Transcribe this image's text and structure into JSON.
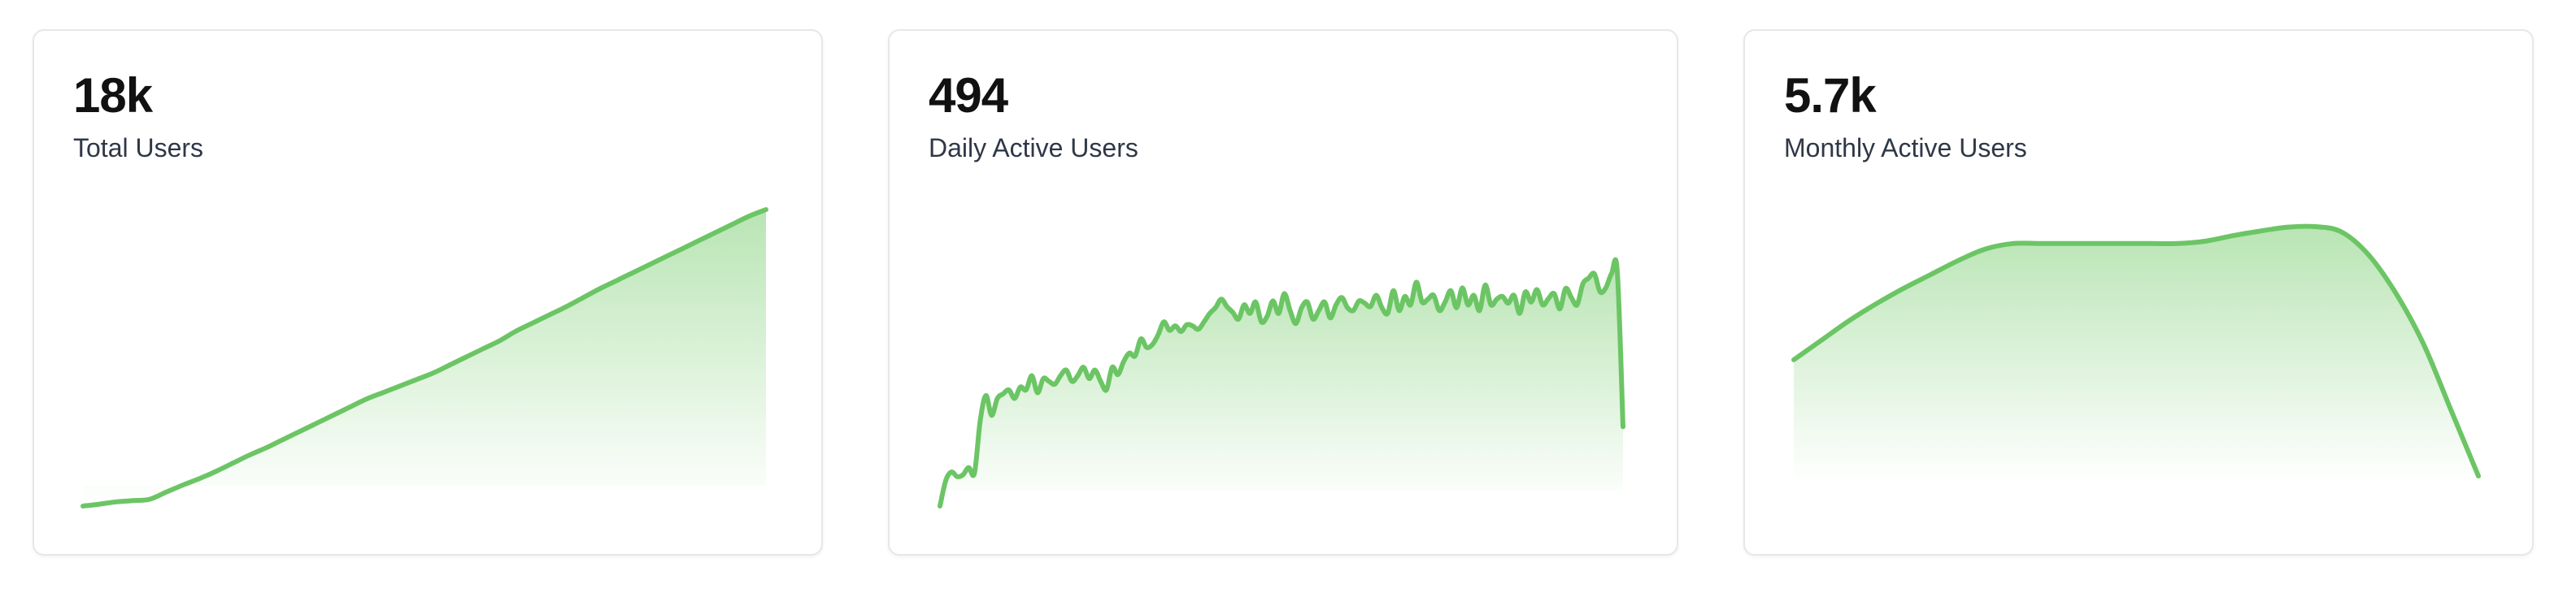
{
  "colors": {
    "line": "#6cc565",
    "fill_top": "#7fcf76"
  },
  "cards": [
    {
      "value": "18k",
      "label": "Total Users",
      "chart_data": {
        "type": "area",
        "y": [
          0,
          120,
          260,
          340,
          420,
          860,
          1300,
          1700,
          2150,
          2650,
          3150,
          3600,
          4100,
          4600,
          5100,
          5600,
          6100,
          6600,
          7000,
          7400,
          7800,
          8200,
          8700,
          9200,
          9700,
          10200,
          10800,
          11300,
          11800,
          12300,
          12850,
          13400,
          13900,
          14400,
          14900,
          15400,
          15900,
          16400,
          16900,
          17400,
          17900,
          18300
        ],
        "ylim": [
          0,
          18300
        ]
      }
    },
    {
      "value": "494",
      "label": "Daily Active Users",
      "chart_data": {
        "type": "area",
        "y": [
          0,
          45,
          60,
          52,
          55,
          68,
          58,
          150,
          195,
          160,
          190,
          198,
          205,
          190,
          210,
          205,
          230,
          200,
          225,
          220,
          215,
          230,
          240,
          220,
          230,
          245,
          225,
          240,
          220,
          205,
          245,
          232,
          255,
          270,
          265,
          295,
          280,
          285,
          302,
          325,
          310,
          318,
          308,
          320,
          318,
          312,
          325,
          340,
          350,
          365,
          352,
          342,
          330,
          355,
          340,
          360,
          325,
          335,
          362,
          340,
          375,
          345,
          322,
          350,
          360,
          330,
          345,
          360,
          332,
          355,
          368,
          350,
          345,
          362,
          358,
          352,
          372,
          350,
          340,
          380,
          345,
          370,
          355,
          395,
          360,
          365,
          372,
          345,
          360,
          380,
          350,
          385,
          355,
          372,
          345,
          390,
          355,
          365,
          370,
          358,
          372,
          340,
          378,
          360,
          382,
          355,
          366,
          375,
          348,
          384,
          368,
          355,
          392,
          402,
          410,
          378,
          385,
          410,
          415,
          140
        ],
        "ylim": [
          0,
          430
        ]
      }
    },
    {
      "value": "5.7k",
      "label": "Monthly Active Users",
      "chart_data": {
        "type": "area",
        "y": [
          3800,
          4050,
          4300,
          4520,
          4720,
          4900,
          5080,
          5230,
          5300,
          5300,
          5300,
          5300,
          5300,
          5300,
          5300,
          5330,
          5400,
          5460,
          5510,
          5520,
          5450,
          5150,
          4650,
          4000,
          3150,
          2300
        ],
        "ylim": [
          2300,
          5550
        ]
      }
    }
  ]
}
